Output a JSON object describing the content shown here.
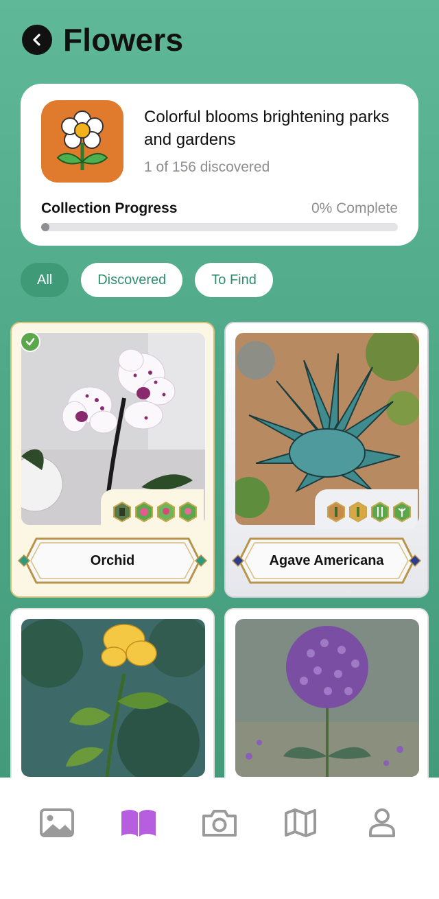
{
  "header": {
    "title": "Flowers"
  },
  "category": {
    "description": "Colorful blooms brightening parks and gardens",
    "discovered_text": "1 of 156 discovered",
    "progress_label": "Collection Progress",
    "progress_percent_text": "0% Complete",
    "progress_fraction": 0.0,
    "icon": "daisy-icon",
    "icon_color": "#e07b2d"
  },
  "filters": [
    {
      "label": "All",
      "active": true
    },
    {
      "label": "Discovered",
      "active": false
    },
    {
      "label": "To Find",
      "active": false
    }
  ],
  "cards": [
    {
      "name": "Orchid",
      "discovered": true,
      "frame": "gold"
    },
    {
      "name": "Agave Americana",
      "discovered": false,
      "frame": "silver"
    },
    {
      "name": "",
      "discovered": false,
      "frame": "plain"
    },
    {
      "name": "",
      "discovered": false,
      "frame": "plain"
    }
  ],
  "tabbar": {
    "tabs": [
      {
        "icon": "gallery-icon",
        "active": false
      },
      {
        "icon": "book-icon",
        "active": true
      },
      {
        "icon": "camera-icon",
        "active": false
      },
      {
        "icon": "map-icon",
        "active": false
      },
      {
        "icon": "profile-icon",
        "active": false
      }
    ],
    "active_color": "#b75ee0",
    "inactive_color": "#9a9a9a"
  },
  "colors": {
    "accent": "#3f9a78",
    "background": "#4ea887"
  }
}
